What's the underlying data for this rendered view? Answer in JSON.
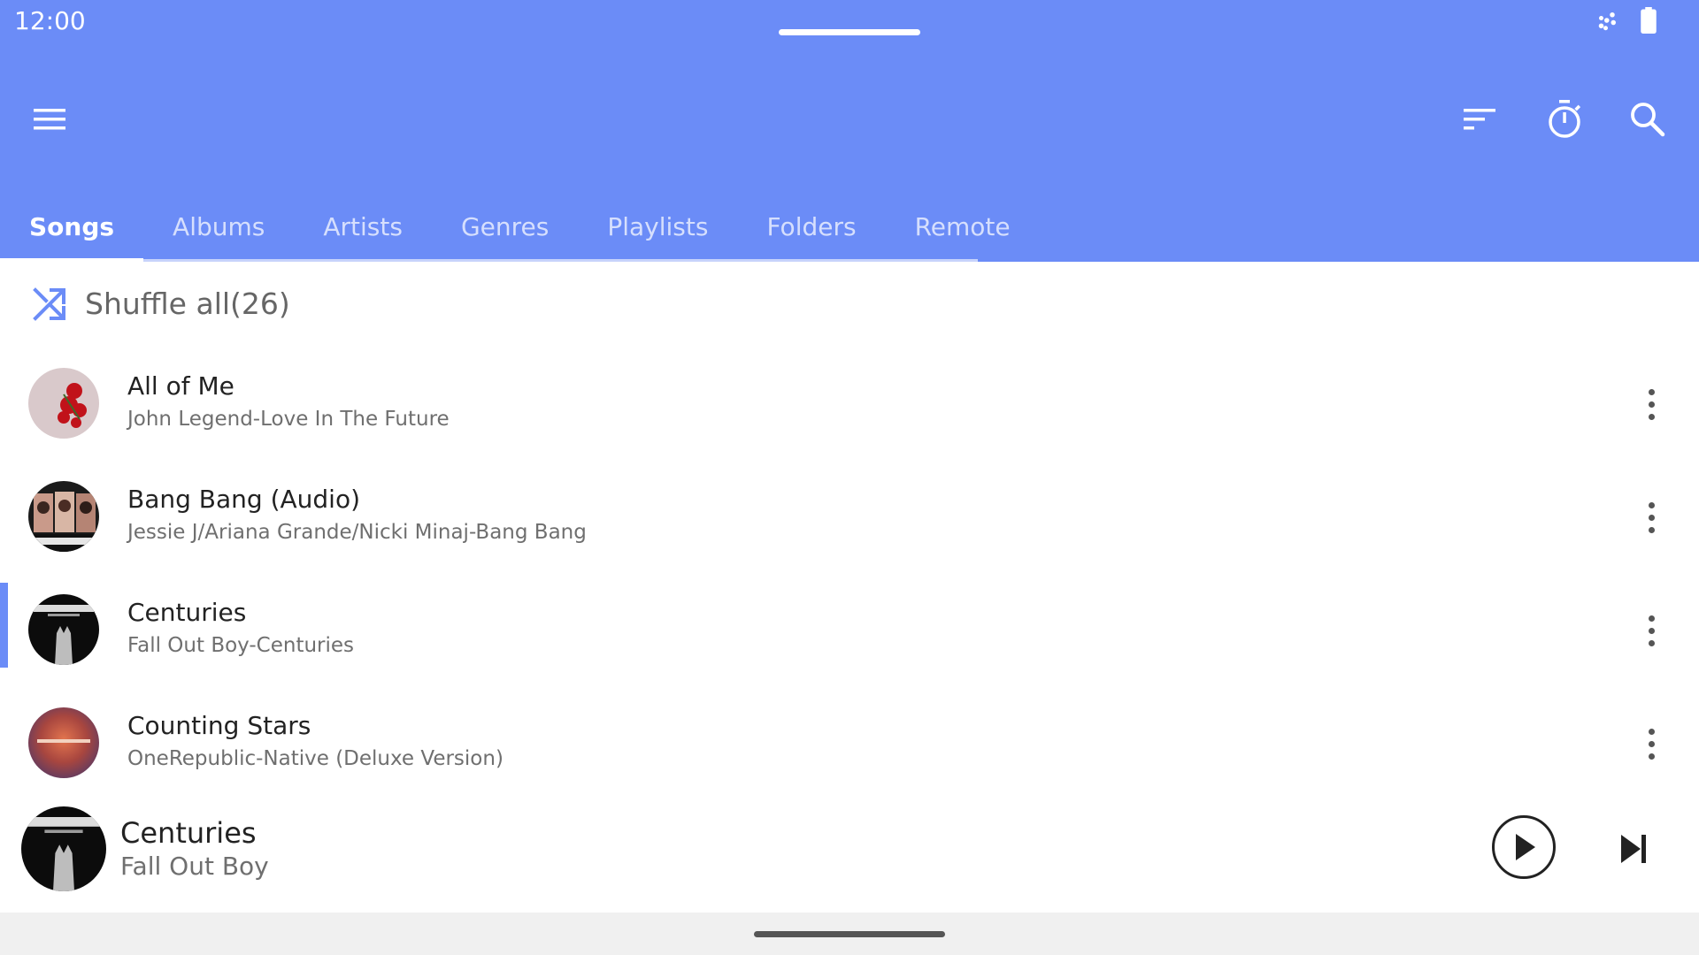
{
  "status_bar": {
    "time": "12:00",
    "icons": [
      "data-saver-icon",
      "battery-icon"
    ]
  },
  "toolbar": {
    "menu_icon": "hamburger-menu-icon",
    "actions": [
      "sort-icon",
      "sleep-timer-icon",
      "search-icon"
    ]
  },
  "tabs": [
    {
      "label": "Songs",
      "active": true
    },
    {
      "label": "Albums",
      "active": false
    },
    {
      "label": "Artists",
      "active": false
    },
    {
      "label": "Genres",
      "active": false
    },
    {
      "label": "Playlists",
      "active": false
    },
    {
      "label": "Folders",
      "active": false
    },
    {
      "label": "Remote",
      "active": false
    }
  ],
  "shuffle": {
    "label": "Shuffle all(26)",
    "icon": "shuffle-icon"
  },
  "songs": [
    {
      "title": "All of Me",
      "subtitle": "John Legend-Love In The Future",
      "current": false
    },
    {
      "title": "Bang Bang (Audio)",
      "subtitle": "Jessie J/Ariana Grande/Nicki Minaj-Bang Bang",
      "current": false
    },
    {
      "title": "Centuries",
      "subtitle": "Fall Out Boy-Centuries",
      "current": true
    },
    {
      "title": "Counting Stars",
      "subtitle": "OneRepublic-Native (Deluxe Version)",
      "current": false
    }
  ],
  "now_playing": {
    "title": "Centuries",
    "artist": "Fall Out Boy",
    "controls": [
      "play-icon",
      "skip-next-icon"
    ]
  },
  "colors": {
    "accent": "#6b8cf7",
    "text_primary": "#222222",
    "text_secondary": "#6f6f6f"
  }
}
